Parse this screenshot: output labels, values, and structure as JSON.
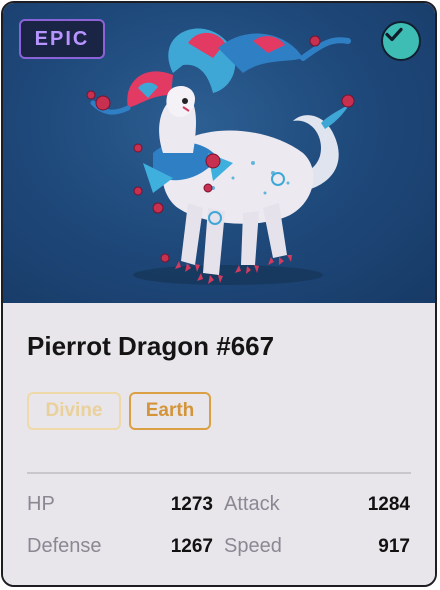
{
  "card": {
    "rarity": "EPIC",
    "name": "Pierrot Dragon #667",
    "verified_icon": "check-circle-icon",
    "image_subject": "dragon-creature-icon",
    "tags": [
      "Divine",
      "Earth"
    ],
    "stats": [
      {
        "label": "HP",
        "value": "1273"
      },
      {
        "label": "Attack",
        "value": "1284"
      },
      {
        "label": "Defense",
        "value": "1267"
      },
      {
        "label": "Speed",
        "value": "917"
      }
    ]
  },
  "colors": {
    "rarity_accent": "#8c62d8",
    "verified_badge": "#3dbdb4",
    "art_background": "#1f4a7c",
    "divine_tag": "#ead19b",
    "earth_tag": "#d4953a"
  }
}
